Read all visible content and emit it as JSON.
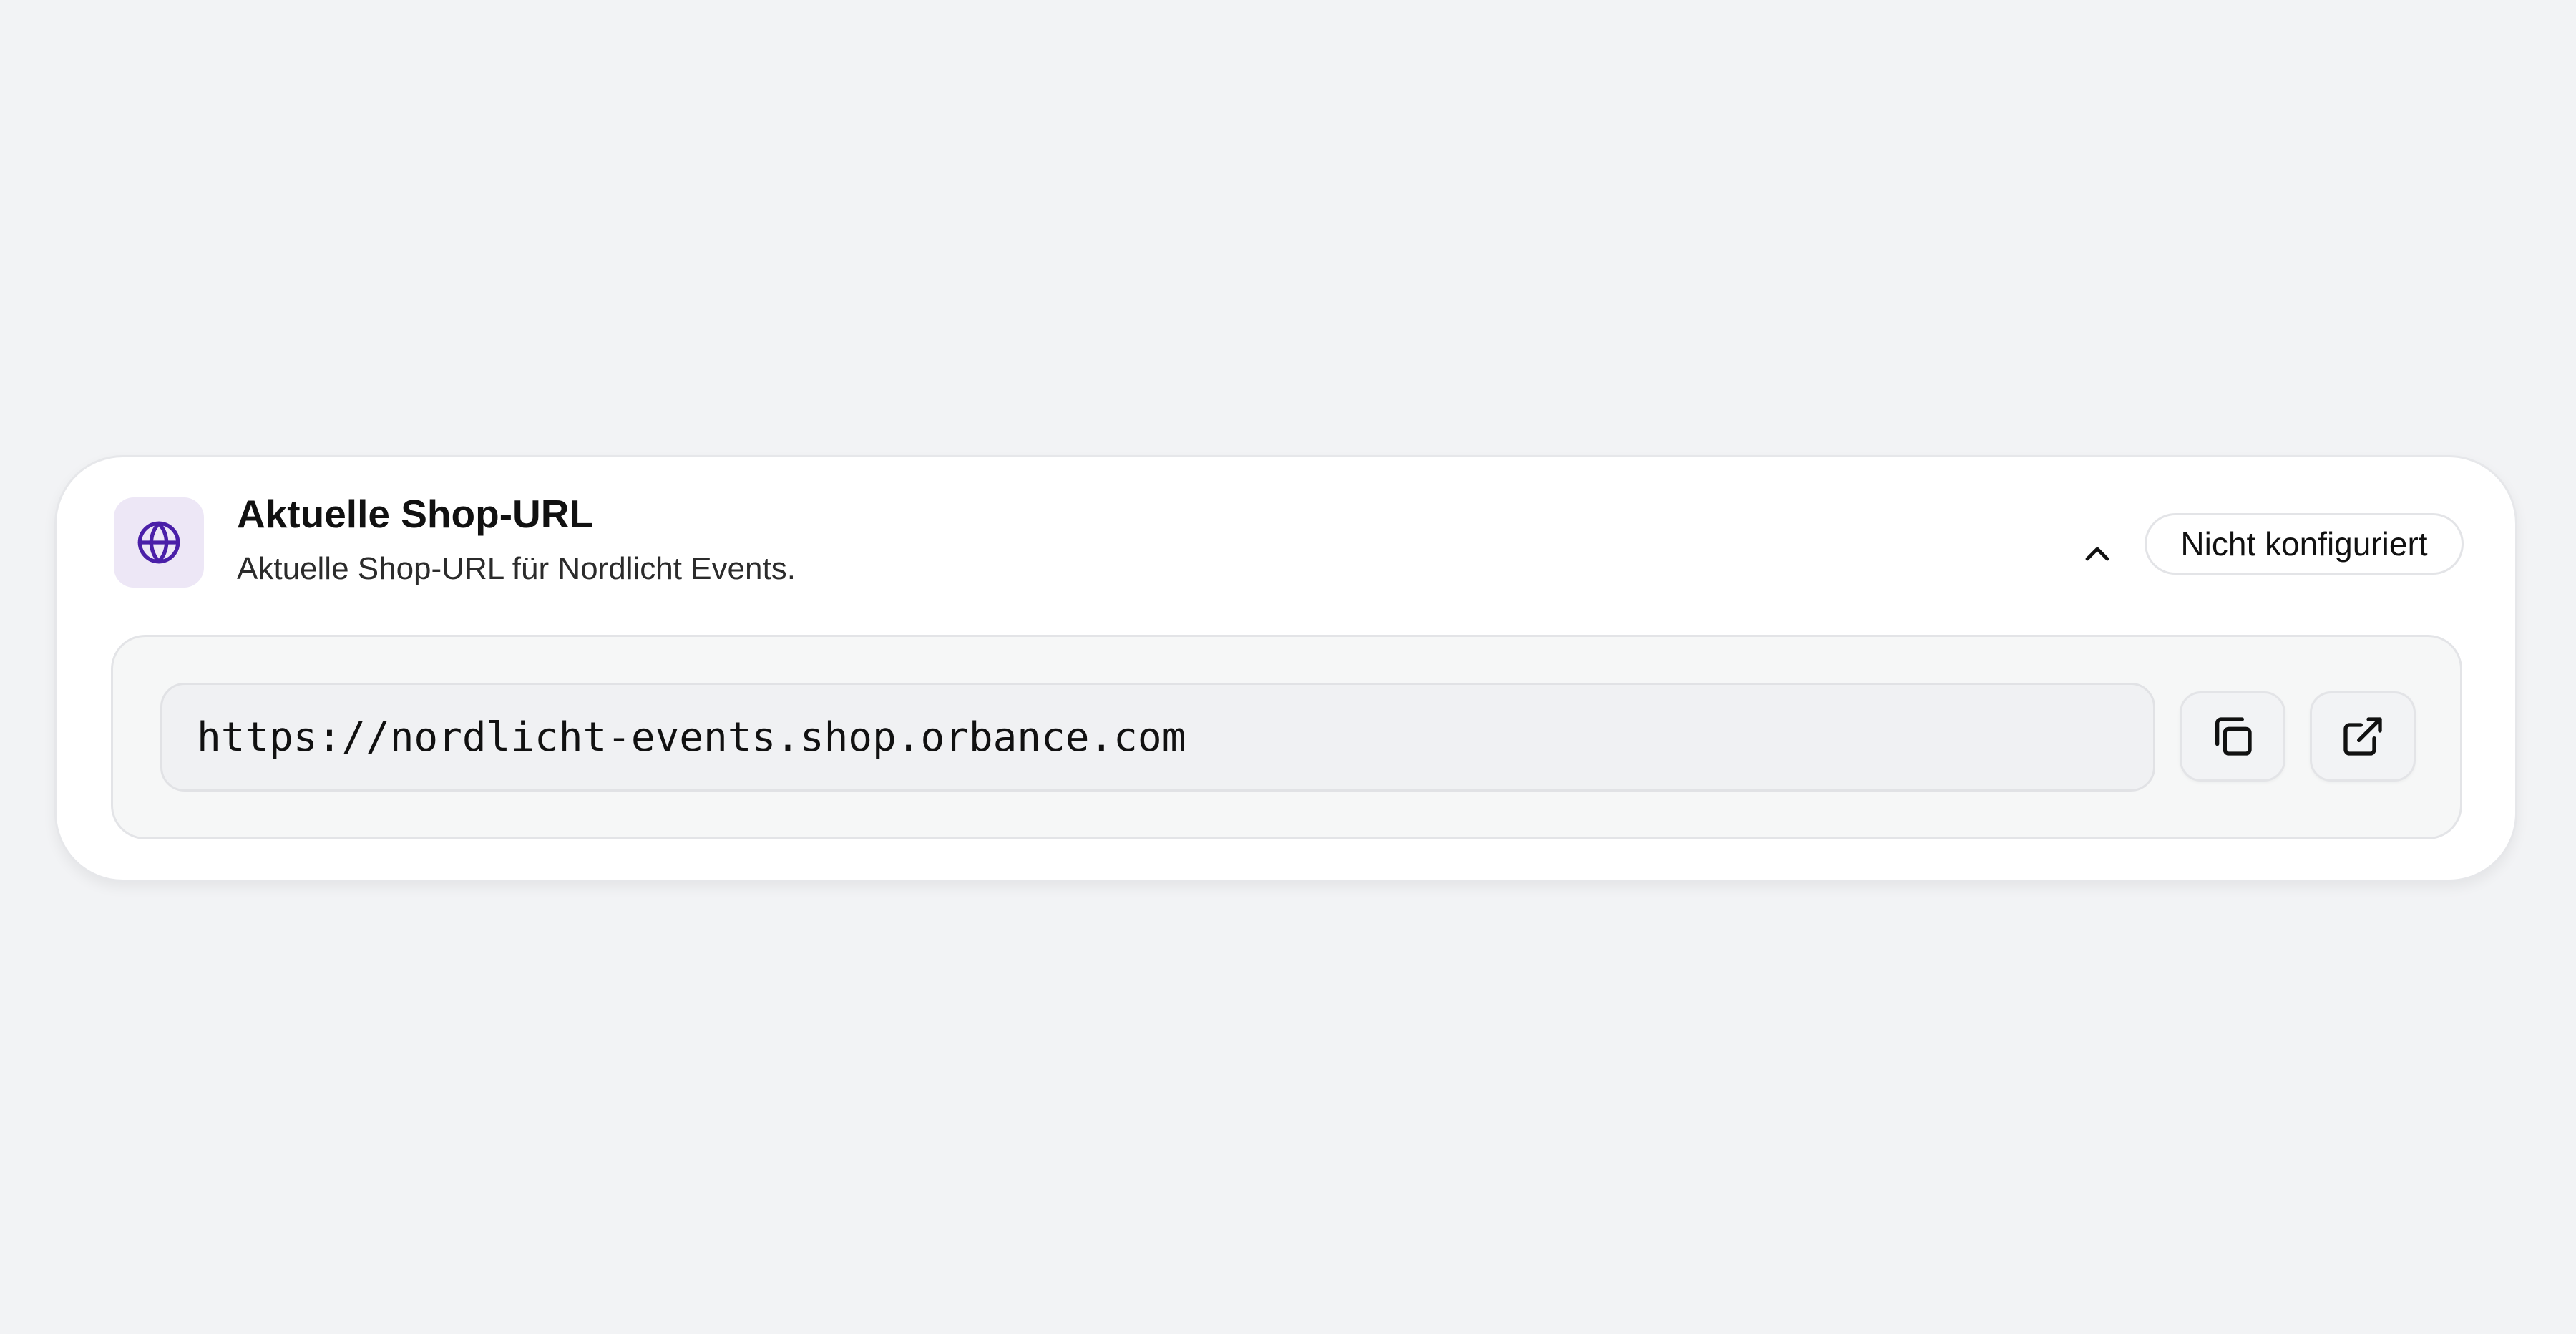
{
  "card": {
    "title": "Aktuelle Shop-URL",
    "subtitle": "Aktuelle Shop-URL für Nordlicht Events.",
    "status": "Nicht konfiguriert",
    "icon": "globe-icon",
    "collapse_icon": "chevron-up-icon"
  },
  "url_panel": {
    "url": "https://nordlicht-events.shop.orbance.com",
    "copy_icon": "copy-icon",
    "open_icon": "external-link-icon"
  },
  "colors": {
    "background": "#f2f3f5",
    "card": "#ffffff",
    "accent": "#4a1fa8",
    "accent_tile": "#ede7f6",
    "panel": "#f6f7f7"
  }
}
